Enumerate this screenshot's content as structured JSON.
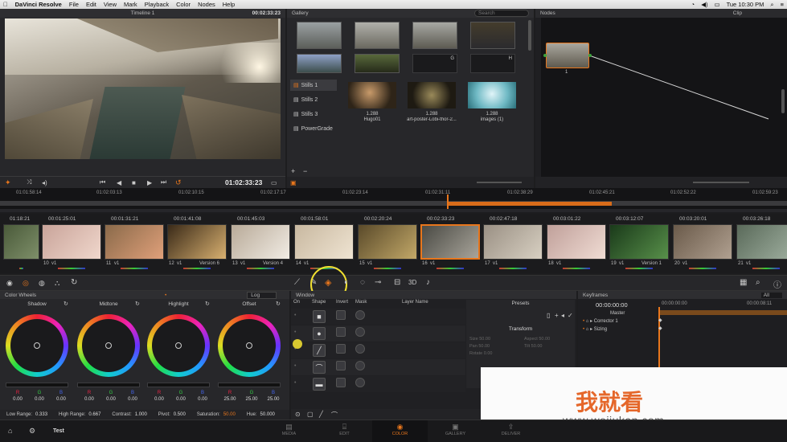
{
  "menubar": {
    "apple": "",
    "app": "DaVinci Resolve",
    "items": [
      "File",
      "Edit",
      "View",
      "Mark",
      "Playback",
      "Color",
      "Nodes",
      "Help"
    ],
    "clock": "Tue 10:30 PM"
  },
  "viewer": {
    "title": "Timeline 1",
    "timecode_top": "00:02:33:23",
    "timecode": "01:02:33:23"
  },
  "gallery": {
    "title": "Gallery",
    "search_placeholder": "Search",
    "stills_albums": [
      "Stills 1",
      "Stills 2",
      "Stills 3",
      "PowerGrade"
    ],
    "grid_labels": [
      "",
      "",
      "G",
      "H"
    ],
    "stills": [
      {
        "id": "1.288",
        "name": "Hugo01"
      },
      {
        "id": "1.288",
        "name": "art-poster-Lobi-thor-2..."
      },
      {
        "id": "1.288",
        "name": "images (1)"
      }
    ]
  },
  "nodes": {
    "title": "Nodes",
    "clip_label": "Clip",
    "node_number": "1"
  },
  "ruler": {
    "ticks": [
      "01:01:58:14",
      "01:02:03:13",
      "01:02:10:15",
      "01:02:17:17",
      "01:02:23:14",
      "01:02:31:11",
      "01:02:38:29",
      "01:02:45:21",
      "01:02:52:22",
      "01:02:59:23"
    ]
  },
  "clips": [
    {
      "tc": "01:18:21",
      "num": "",
      "ver": ""
    },
    {
      "tc": "00:01:25:01",
      "num": "10",
      "ver": "v1"
    },
    {
      "tc": "00:01:31:21",
      "num": "11",
      "ver": "v1"
    },
    {
      "tc": "00:01:41:08",
      "num": "12",
      "ver": "v1",
      "version": "Version 6"
    },
    {
      "tc": "00:01:45:03",
      "num": "13",
      "ver": "v1",
      "version": "Version 4"
    },
    {
      "tc": "00:01:58:01",
      "num": "14",
      "ver": "v1"
    },
    {
      "tc": "00:02:20:24",
      "num": "15",
      "ver": "v1"
    },
    {
      "tc": "00:02:33:23",
      "num": "16",
      "ver": "v1"
    },
    {
      "tc": "00:02:47:18",
      "num": "17",
      "ver": "v1"
    },
    {
      "tc": "00:03:01:22",
      "num": "18",
      "ver": "v1"
    },
    {
      "tc": "00:03:12:07",
      "num": "19",
      "ver": "v1",
      "version": "Version 1"
    },
    {
      "tc": "00:03:20:01",
      "num": "20",
      "ver": "v1"
    },
    {
      "tc": "00:03:26:18",
      "num": "21",
      "ver": "v1"
    }
  ],
  "colorwheels": {
    "title": "Color Wheels",
    "mode": "Log",
    "wheels": [
      {
        "name": "Shadow",
        "r": "0.00",
        "g": "0.00",
        "b": "0.00"
      },
      {
        "name": "Midtone",
        "r": "0.00",
        "g": "0.00",
        "b": "0.00"
      },
      {
        "name": "Highlight",
        "r": "0.00",
        "g": "0.00",
        "b": "0.00"
      },
      {
        "name": "Offset",
        "r": "25.00",
        "g": "25.00",
        "b": "25.00"
      }
    ],
    "channel_labels": [
      "R",
      "G",
      "B"
    ],
    "bottom": {
      "low_range_label": "Low Range:",
      "low_range": "0.333",
      "high_range_label": "High Range:",
      "high_range": "0.667",
      "contrast_label": "Contrast:",
      "contrast": "1.000",
      "pivot_label": "Pivot:",
      "pivot": "0.500",
      "saturation_label": "Saturation:",
      "saturation": "50.00",
      "hue_label": "Hue:",
      "hue": "50.000"
    }
  },
  "window": {
    "title": "Window",
    "cols": [
      "On",
      "Shape",
      "Invert",
      "Mask",
      "Layer Name"
    ],
    "presets": "Presets",
    "transform": "Transform",
    "fields": [
      {
        "l": "Size",
        "v": "50.00"
      },
      {
        "l": "Aspect",
        "v": "50.00"
      },
      {
        "l": "Pan",
        "v": "50.00"
      },
      {
        "l": "Tilt",
        "v": "50.00"
      },
      {
        "l": "Rotate",
        "v": "0.00"
      }
    ]
  },
  "keyframes": {
    "title": "Keyframes",
    "filter": "All",
    "timecode": "00:00:00:00",
    "ruler_start": "00:00:00:00",
    "ruler_end": "00:00:08:11",
    "tracks": [
      "Master",
      "Corrector 1",
      "Sizing"
    ]
  },
  "pages": {
    "project": "Test",
    "tabs": [
      "MEDIA",
      "EDIT",
      "COLOR",
      "GALLERY",
      "DELIVER"
    ],
    "active": "COLOR"
  },
  "watermark": {
    "text": "我就看",
    "url": "www.wojiukan.com"
  },
  "colors": {
    "accent": "#e8761c",
    "highlight_ring": "#f0e030"
  }
}
